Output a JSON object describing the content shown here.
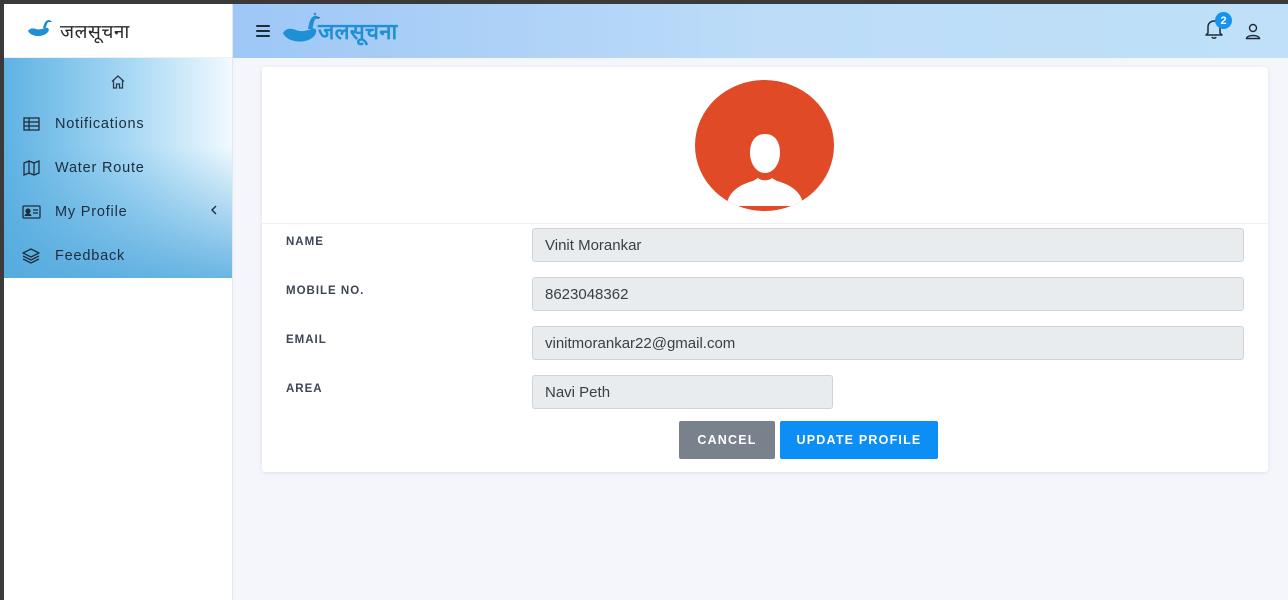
{
  "app": {
    "brand_name": "जलसूचना",
    "header_logo_text": "जलसूचना"
  },
  "sidebar": {
    "items": [
      {
        "label": "Notifications",
        "icon": "table-icon"
      },
      {
        "label": "Water Route",
        "icon": "map-icon"
      },
      {
        "label": "My Profile",
        "icon": "id-card-icon"
      },
      {
        "label": "Feedback",
        "icon": "layers-icon"
      }
    ]
  },
  "header": {
    "notification_count": "2"
  },
  "profile": {
    "fields": [
      {
        "label": "NAME",
        "value": "Vinit Morankar"
      },
      {
        "label": "MOBILE NO.",
        "value": "8623048362"
      },
      {
        "label": "EMAIL",
        "value": "vinitmorankar22@gmail.com"
      },
      {
        "label": "AREA",
        "value": "Navi Peth"
      }
    ],
    "cancel_label": "CANCEL",
    "update_label": "UPDATE PROFILE"
  },
  "colors": {
    "accent": "#0d8ef4",
    "avatar_bg": "#e04a26",
    "cancel_bg": "#78818c",
    "badge_bg": "#1593ee"
  }
}
